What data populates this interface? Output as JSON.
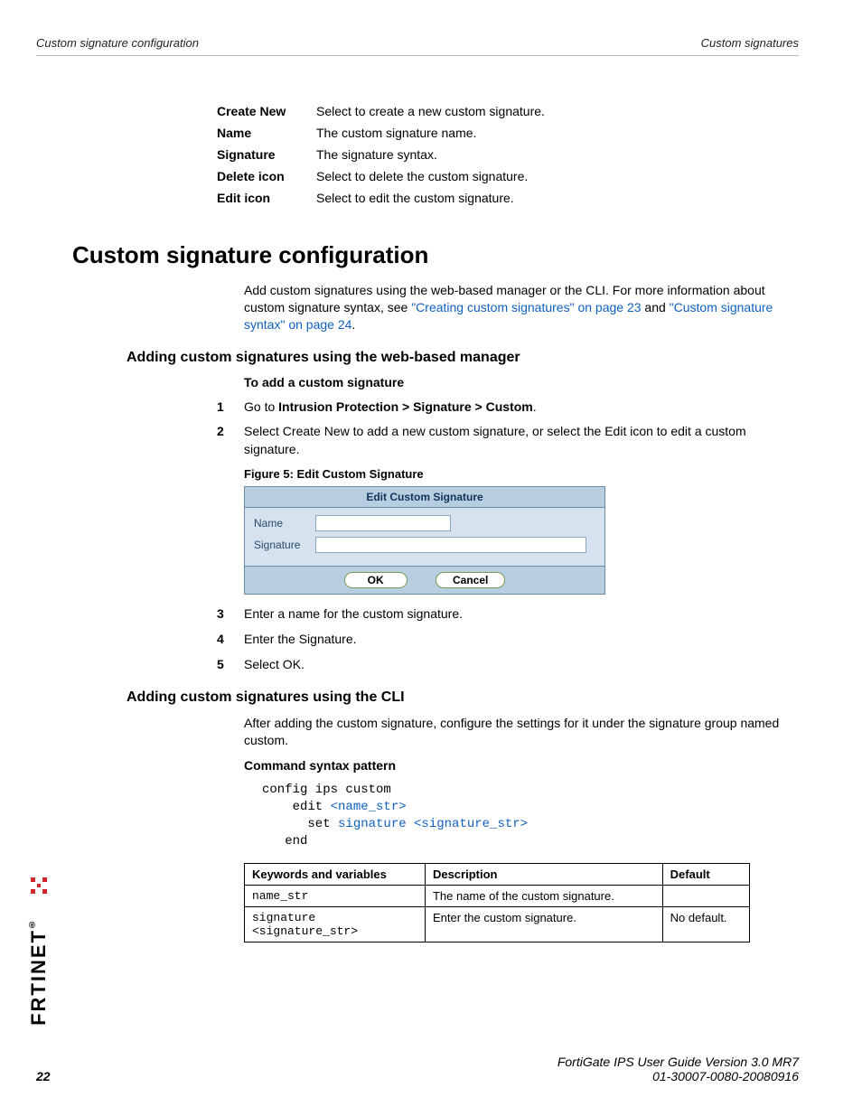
{
  "header": {
    "left": "Custom signature configuration",
    "right": "Custom signatures"
  },
  "topDefs": [
    {
      "term": "Create New",
      "def": "Select to create a new custom signature."
    },
    {
      "term": "Name",
      "def": "The custom signature name."
    },
    {
      "term": "Signature",
      "def": "The signature syntax."
    },
    {
      "term": "Delete icon",
      "def": "Select to delete the custom signature."
    },
    {
      "term": "Edit icon",
      "def": "Select to edit the custom signature."
    }
  ],
  "h1": "Custom signature configuration",
  "intro": {
    "pre": "Add custom signatures using the web-based manager or the CLI. For more information about custom signature syntax, see ",
    "link1": "\"Creating custom signatures\" on page 23",
    "mid": " and ",
    "link2": "\"Custom signature syntax\" on page 24",
    "post": "."
  },
  "h2a": "Adding custom signatures using the web-based manager",
  "h3a": "To add a custom signature",
  "steps1": {
    "s1_pre": "Go to ",
    "s1_bold": "Intrusion Protection > Signature > Custom",
    "s1_post": ".",
    "s2": "Select Create New to add a new custom signature, or select the Edit icon to edit a custom signature."
  },
  "figCaption": "Figure 5:   Edit Custom Signature",
  "ecs": {
    "title": "Edit Custom Signature",
    "nameLabel": "Name",
    "sigLabel": "Signature",
    "ok": "OK",
    "cancel": "Cancel"
  },
  "steps2": {
    "s3": "Enter a name for the custom signature.",
    "s4": "Enter the Signature.",
    "s5": "Select OK."
  },
  "h2b": "Adding custom signatures using the CLI",
  "cliPara": "After adding the custom signature, configure the settings for it under the signature group named custom.",
  "h3b": "Command syntax pattern",
  "code": {
    "l1": "config ips custom",
    "l2a": "    edit ",
    "l2b": "<name_str>",
    "l3a": "      set ",
    "l3b": "signature <signature_str>",
    "l4": "   end"
  },
  "table": {
    "h1": "Keywords and variables",
    "h2": "Description",
    "h3": "Default",
    "r1c1": "name_str",
    "r1c2": "The name of the custom signature.",
    "r1c3": "",
    "r2c1a": "signature",
    "r2c1b": "<signature_str>",
    "r2c2": "Enter the custom signature.",
    "r2c3": "No default."
  },
  "fortinetText": "F:::RTINET",
  "footer": {
    "page": "22",
    "line1": "FortiGate IPS User Guide Version 3.0 MR7",
    "line2": "01-30007-0080-20080916"
  }
}
